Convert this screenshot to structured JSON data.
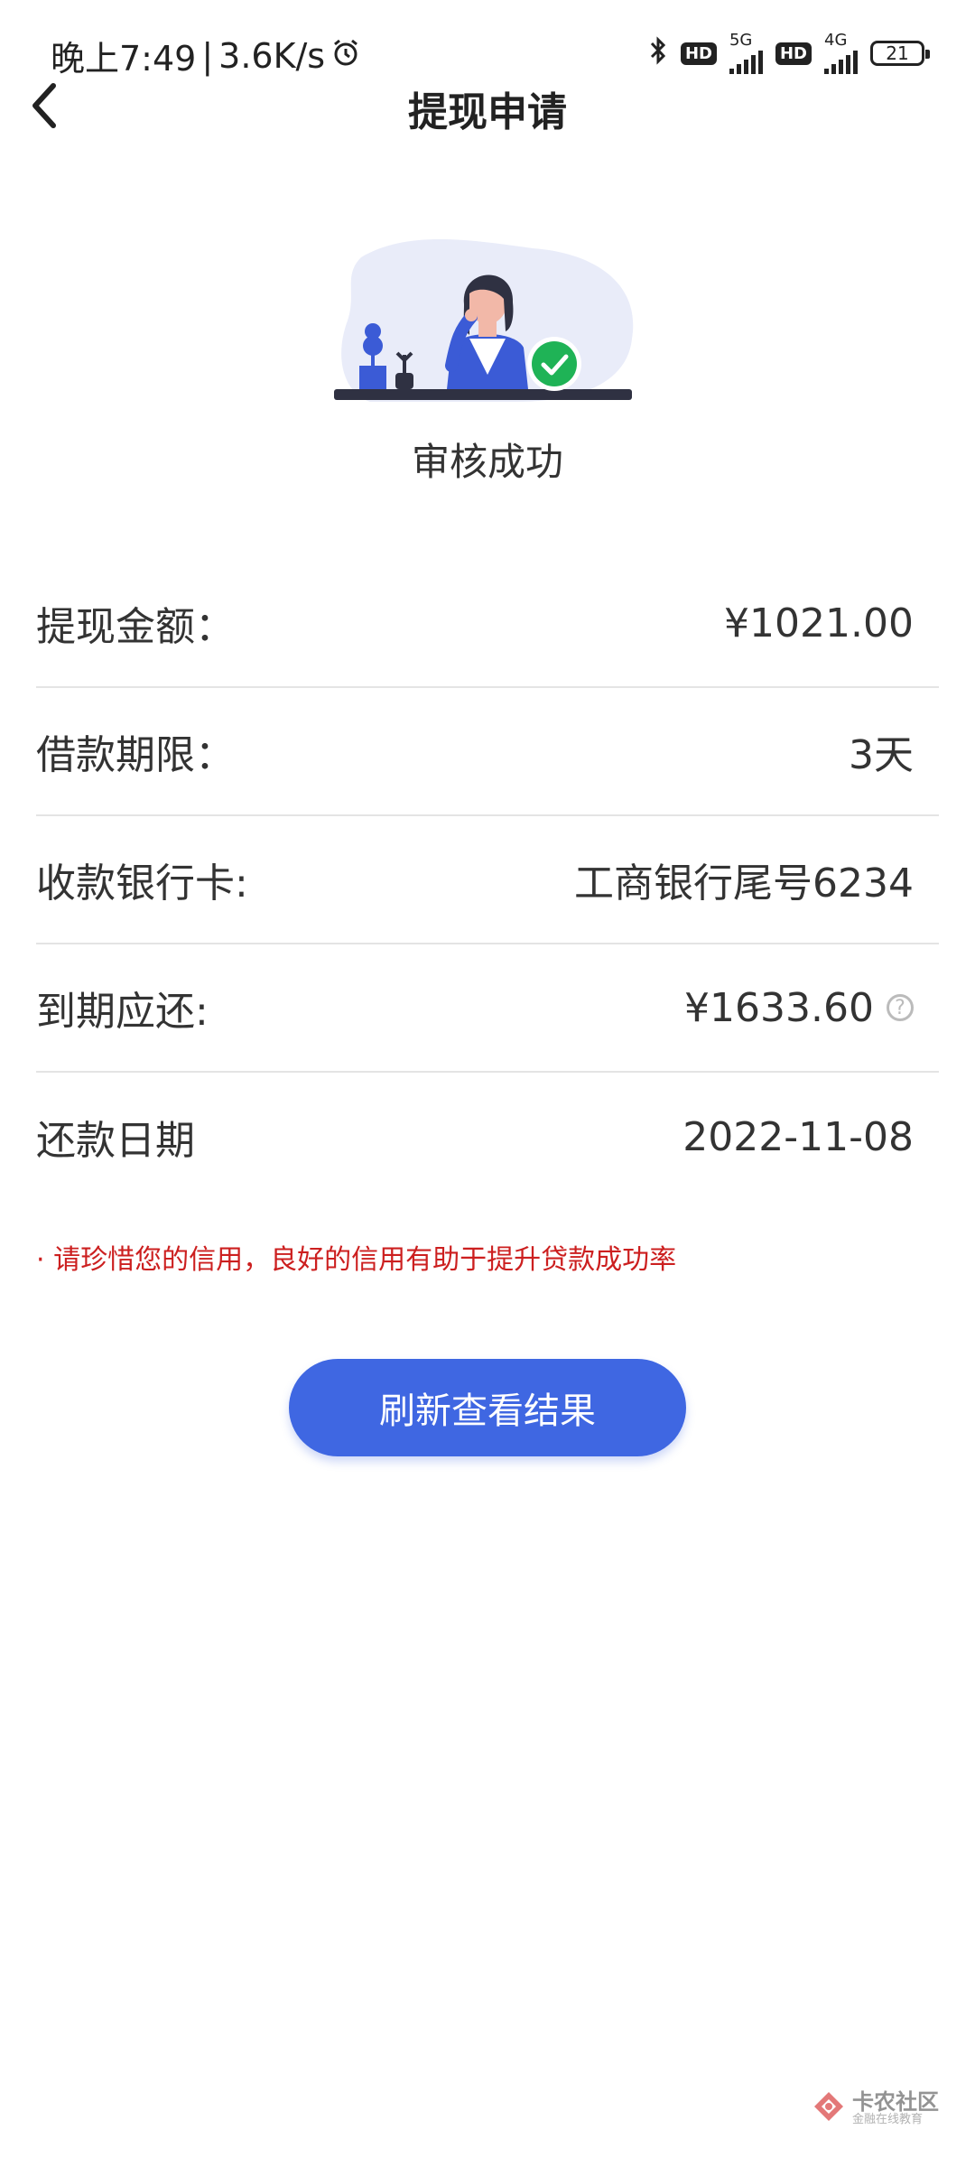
{
  "status_bar": {
    "time": "晚上7:49",
    "separator": "|",
    "speed": "3.6K/s",
    "hd1": "HD",
    "net1": "5G",
    "hd2": "HD",
    "net2": "4G",
    "battery": "21",
    "icons": [
      "alarm-icon",
      "bluetooth-icon",
      "signal-icon",
      "battery-icon"
    ]
  },
  "nav": {
    "back_icon": "chevron-left-icon",
    "title": "提现申请"
  },
  "hero": {
    "caption": "审核成功",
    "status_icon": "check-circle-icon"
  },
  "details": [
    {
      "label": "提现金额：",
      "value": "¥1021.00"
    },
    {
      "label": "借款期限：",
      "value": "3天"
    },
    {
      "label": "收款银行卡:",
      "value": "工商银行尾号6234"
    },
    {
      "label": "到期应还:",
      "value": "¥1633.60",
      "help_icon": "question-circle-icon",
      "help_symbol": "?"
    },
    {
      "label": "还款日期",
      "value": "2022-11-08"
    }
  ],
  "notice": "· 请珍惜您的信用，良好的信用有助于提升贷款成功率",
  "refresh_button": "刷新查看结果",
  "watermark": {
    "main": "卡农社区",
    "sub": "金融在线教育"
  },
  "colors": {
    "accent": "#3f67e2",
    "notice": "#cc1f1f",
    "success": "#1fb356"
  }
}
